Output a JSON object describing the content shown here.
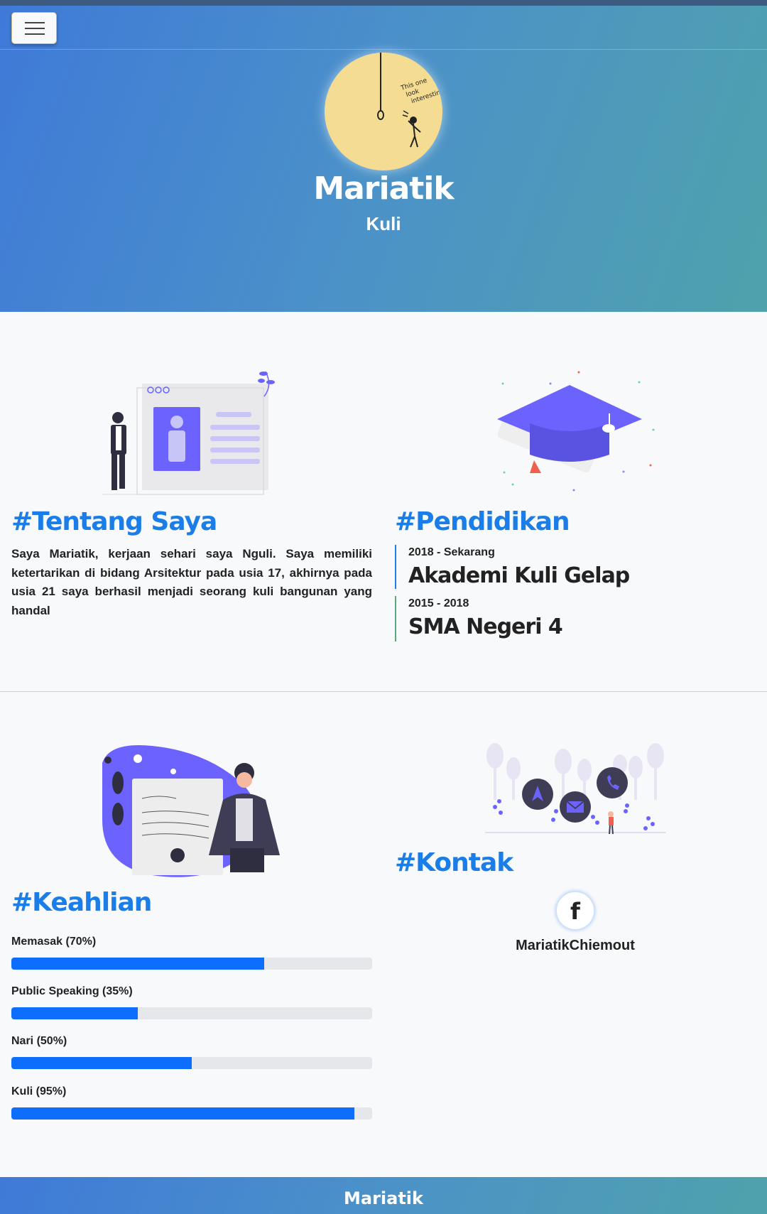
{
  "hero": {
    "name": "Mariatik",
    "job": "Kuli",
    "avatar_note": "This one look interesting"
  },
  "about": {
    "heading": "#Tentang Saya",
    "text": "Saya Mariatik, kerjaan sehari saya Nguli. Saya memiliki ketertarikan di bidang Arsitektur pada usia 17, akhirnya pada usia 21 saya berhasil menjadi seorang kuli bangunan yang handal"
  },
  "education": {
    "heading": "#Pendidikan",
    "items": [
      {
        "years": "2018 - Sekarang",
        "school": "Akademi Kuli Gelap"
      },
      {
        "years": "2015 - 2018",
        "school": "SMA Negeri 4"
      }
    ]
  },
  "skills": {
    "heading": "#Keahlian",
    "items": [
      {
        "label": "Memasak (70%)",
        "percent": 70
      },
      {
        "label": "Public Speaking (35%)",
        "percent": 35
      },
      {
        "label": "Nari (50%)",
        "percent": 50
      },
      {
        "label": "Kuli (95%)",
        "percent": 95
      }
    ]
  },
  "contact": {
    "heading": "#Kontak",
    "icon": "facebook-icon",
    "facebook_glyph": "f",
    "username": "MariatikChiemout"
  },
  "footer": {
    "name": "Mariatik"
  },
  "colors": {
    "accent": "#1a7de8",
    "progress": "#0d6efd",
    "hero_start": "#3f7ad8",
    "hero_end": "#4fa2ac",
    "avatar_bg": "#f4dd93",
    "illustration_purple": "#6c63ff"
  }
}
